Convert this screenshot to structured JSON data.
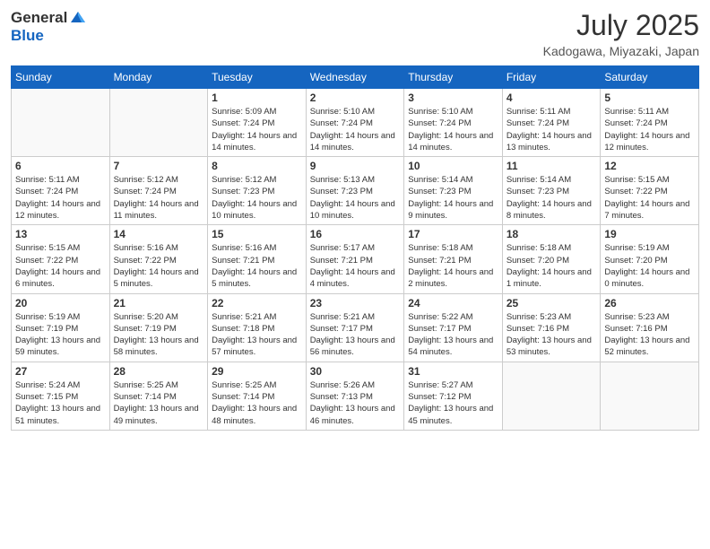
{
  "logo": {
    "general": "General",
    "blue": "Blue"
  },
  "header": {
    "month": "July 2025",
    "location": "Kadogawa, Miyazaki, Japan"
  },
  "weekdays": [
    "Sunday",
    "Monday",
    "Tuesday",
    "Wednesday",
    "Thursday",
    "Friday",
    "Saturday"
  ],
  "weeks": [
    [
      {
        "day": null,
        "info": null
      },
      {
        "day": null,
        "info": null
      },
      {
        "day": "1",
        "info": "Sunrise: 5:09 AM\nSunset: 7:24 PM\nDaylight: 14 hours and 14 minutes."
      },
      {
        "day": "2",
        "info": "Sunrise: 5:10 AM\nSunset: 7:24 PM\nDaylight: 14 hours and 14 minutes."
      },
      {
        "day": "3",
        "info": "Sunrise: 5:10 AM\nSunset: 7:24 PM\nDaylight: 14 hours and 14 minutes."
      },
      {
        "day": "4",
        "info": "Sunrise: 5:11 AM\nSunset: 7:24 PM\nDaylight: 14 hours and 13 minutes."
      },
      {
        "day": "5",
        "info": "Sunrise: 5:11 AM\nSunset: 7:24 PM\nDaylight: 14 hours and 12 minutes."
      }
    ],
    [
      {
        "day": "6",
        "info": "Sunrise: 5:11 AM\nSunset: 7:24 PM\nDaylight: 14 hours and 12 minutes."
      },
      {
        "day": "7",
        "info": "Sunrise: 5:12 AM\nSunset: 7:24 PM\nDaylight: 14 hours and 11 minutes."
      },
      {
        "day": "8",
        "info": "Sunrise: 5:12 AM\nSunset: 7:23 PM\nDaylight: 14 hours and 10 minutes."
      },
      {
        "day": "9",
        "info": "Sunrise: 5:13 AM\nSunset: 7:23 PM\nDaylight: 14 hours and 10 minutes."
      },
      {
        "day": "10",
        "info": "Sunrise: 5:14 AM\nSunset: 7:23 PM\nDaylight: 14 hours and 9 minutes."
      },
      {
        "day": "11",
        "info": "Sunrise: 5:14 AM\nSunset: 7:23 PM\nDaylight: 14 hours and 8 minutes."
      },
      {
        "day": "12",
        "info": "Sunrise: 5:15 AM\nSunset: 7:22 PM\nDaylight: 14 hours and 7 minutes."
      }
    ],
    [
      {
        "day": "13",
        "info": "Sunrise: 5:15 AM\nSunset: 7:22 PM\nDaylight: 14 hours and 6 minutes."
      },
      {
        "day": "14",
        "info": "Sunrise: 5:16 AM\nSunset: 7:22 PM\nDaylight: 14 hours and 5 minutes."
      },
      {
        "day": "15",
        "info": "Sunrise: 5:16 AM\nSunset: 7:21 PM\nDaylight: 14 hours and 5 minutes."
      },
      {
        "day": "16",
        "info": "Sunrise: 5:17 AM\nSunset: 7:21 PM\nDaylight: 14 hours and 4 minutes."
      },
      {
        "day": "17",
        "info": "Sunrise: 5:18 AM\nSunset: 7:21 PM\nDaylight: 14 hours and 2 minutes."
      },
      {
        "day": "18",
        "info": "Sunrise: 5:18 AM\nSunset: 7:20 PM\nDaylight: 14 hours and 1 minute."
      },
      {
        "day": "19",
        "info": "Sunrise: 5:19 AM\nSunset: 7:20 PM\nDaylight: 14 hours and 0 minutes."
      }
    ],
    [
      {
        "day": "20",
        "info": "Sunrise: 5:19 AM\nSunset: 7:19 PM\nDaylight: 13 hours and 59 minutes."
      },
      {
        "day": "21",
        "info": "Sunrise: 5:20 AM\nSunset: 7:19 PM\nDaylight: 13 hours and 58 minutes."
      },
      {
        "day": "22",
        "info": "Sunrise: 5:21 AM\nSunset: 7:18 PM\nDaylight: 13 hours and 57 minutes."
      },
      {
        "day": "23",
        "info": "Sunrise: 5:21 AM\nSunset: 7:17 PM\nDaylight: 13 hours and 56 minutes."
      },
      {
        "day": "24",
        "info": "Sunrise: 5:22 AM\nSunset: 7:17 PM\nDaylight: 13 hours and 54 minutes."
      },
      {
        "day": "25",
        "info": "Sunrise: 5:23 AM\nSunset: 7:16 PM\nDaylight: 13 hours and 53 minutes."
      },
      {
        "day": "26",
        "info": "Sunrise: 5:23 AM\nSunset: 7:16 PM\nDaylight: 13 hours and 52 minutes."
      }
    ],
    [
      {
        "day": "27",
        "info": "Sunrise: 5:24 AM\nSunset: 7:15 PM\nDaylight: 13 hours and 51 minutes."
      },
      {
        "day": "28",
        "info": "Sunrise: 5:25 AM\nSunset: 7:14 PM\nDaylight: 13 hours and 49 minutes."
      },
      {
        "day": "29",
        "info": "Sunrise: 5:25 AM\nSunset: 7:14 PM\nDaylight: 13 hours and 48 minutes."
      },
      {
        "day": "30",
        "info": "Sunrise: 5:26 AM\nSunset: 7:13 PM\nDaylight: 13 hours and 46 minutes."
      },
      {
        "day": "31",
        "info": "Sunrise: 5:27 AM\nSunset: 7:12 PM\nDaylight: 13 hours and 45 minutes."
      },
      {
        "day": null,
        "info": null
      },
      {
        "day": null,
        "info": null
      }
    ]
  ]
}
